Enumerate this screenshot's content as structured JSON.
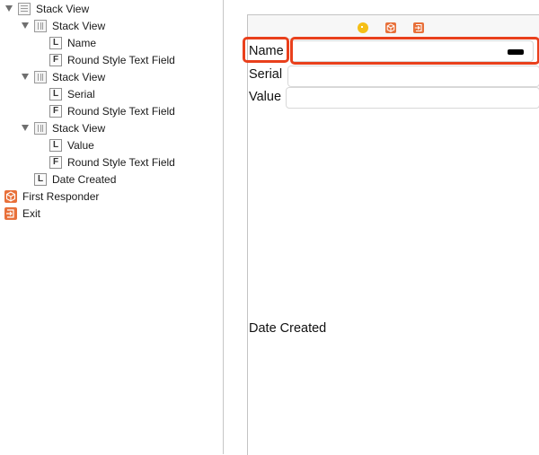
{
  "outline": {
    "items": [
      {
        "label": "Stack View"
      },
      {
        "label": "Stack View"
      },
      {
        "label": "Name"
      },
      {
        "label": "Round Style Text Field"
      },
      {
        "label": "Stack View"
      },
      {
        "label": "Serial"
      },
      {
        "label": "Round Style Text Field"
      },
      {
        "label": "Stack View"
      },
      {
        "label": "Value"
      },
      {
        "label": "Round Style Text Field"
      },
      {
        "label": "Date Created"
      },
      {
        "label": "First Responder"
      },
      {
        "label": "Exit"
      }
    ],
    "icon_letters": {
      "label": "L",
      "text_field": "F"
    }
  },
  "scene": {
    "name_label": "Name",
    "serial_label": "Serial",
    "value_label": "Value",
    "date_label": "Date Created",
    "dock_icons": [
      "view-controller-icon",
      "first-responder-icon",
      "exit-icon"
    ]
  },
  "colors": {
    "highlight": "#e9401c",
    "orange_icon": "#e8703a",
    "yellow_icon": "#f5bf16"
  }
}
